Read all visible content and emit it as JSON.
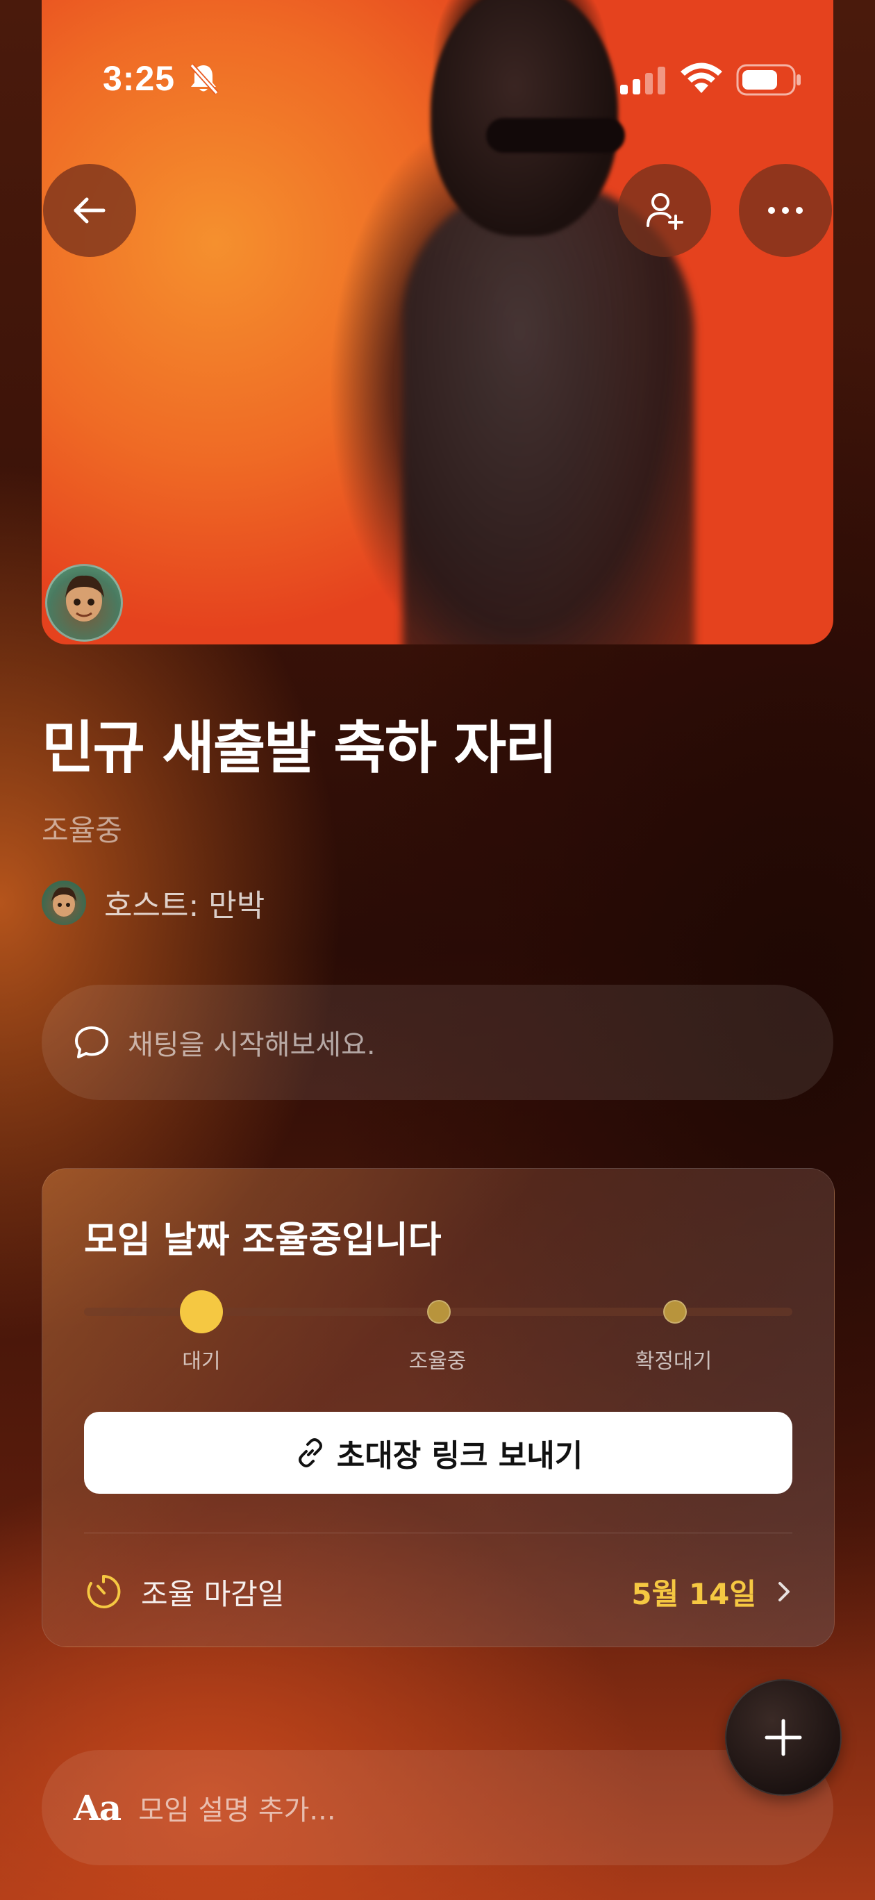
{
  "status_bar": {
    "time": "3:25",
    "icons": [
      "bell-muted-icon",
      "cellular-signal-icon",
      "wifi-icon",
      "battery-icon"
    ]
  },
  "hero": {
    "icons": [
      "back-arrow-icon",
      "add-person-icon",
      "more-dots-icon"
    ]
  },
  "event": {
    "title": "민규 새출발 축하 자리",
    "status": "조율중",
    "host": "호스트: 만박"
  },
  "chat": {
    "placeholder": "채팅을 시작해보세요.",
    "icon": "chat-bubble-icon"
  },
  "schedule_card": {
    "title": "모임 날짜 조율중입니다",
    "steps": [
      {
        "label": "대기",
        "active": true
      },
      {
        "label": "조율중",
        "active": false
      },
      {
        "label": "확정대기",
        "active": false
      }
    ],
    "invite_button_label": "초대장 링크 보내기",
    "invite_icon": "link-icon",
    "deadline_label": "조율 마감일",
    "deadline_date": "5월 14일",
    "deadline_icon": "timer-icon",
    "accent_color": "#f5c842"
  },
  "description": {
    "icon_text": "Aa",
    "placeholder": "모임 설명 추가..."
  },
  "fab": {
    "icon": "plus-icon"
  }
}
